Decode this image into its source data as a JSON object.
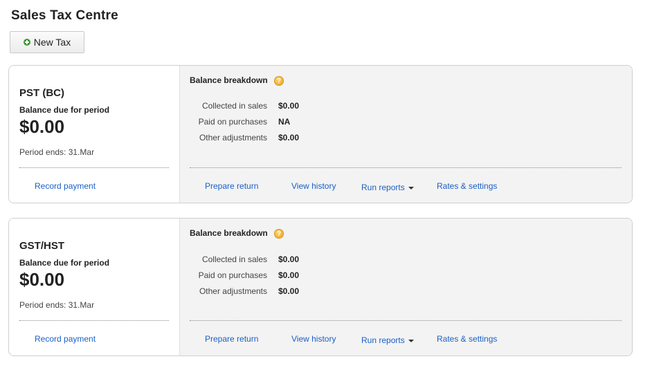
{
  "page": {
    "title": "Sales Tax Centre"
  },
  "toolbar": {
    "new_tax_label": "New Tax",
    "new_tax_icon": "plus-circle-icon"
  },
  "taxes": [
    {
      "name": "PST (BC)",
      "balance_label": "Balance due for period",
      "balance_amount": "$0.00",
      "period_ends": "Period ends: 31.Mar",
      "record_payment": "Record payment",
      "breakdown_title": "Balance breakdown",
      "rows": [
        {
          "label": "Collected in sales",
          "value": "$0.00"
        },
        {
          "label": "Paid on purchases",
          "value": "NA"
        },
        {
          "label": "Other adjustments",
          "value": "$0.00"
        }
      ],
      "actions": {
        "prepare_return": "Prepare return",
        "view_history": "View history",
        "run_reports": "Run reports",
        "rates_settings": "Rates & settings"
      }
    },
    {
      "name": "GST/HST",
      "balance_label": "Balance due for period",
      "balance_amount": "$0.00",
      "period_ends": "Period ends: 31.Mar",
      "record_payment": "Record payment",
      "breakdown_title": "Balance breakdown",
      "rows": [
        {
          "label": "Collected in sales",
          "value": "$0.00"
        },
        {
          "label": "Paid on purchases",
          "value": "$0.00"
        },
        {
          "label": "Other adjustments",
          "value": "$0.00"
        }
      ],
      "actions": {
        "prepare_return": "Prepare return",
        "view_history": "View history",
        "run_reports": "Run reports",
        "rates_settings": "Rates & settings"
      }
    }
  ],
  "colors": {
    "link": "#1a5fc4",
    "panel_bg": "#f3f3f3",
    "help_icon": "#e59d14"
  }
}
